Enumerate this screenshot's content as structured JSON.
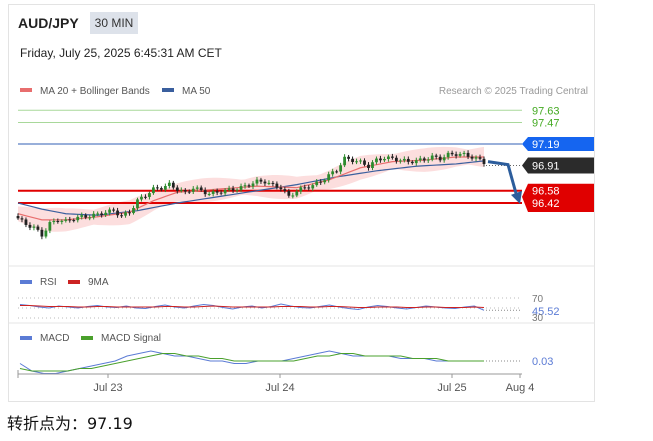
{
  "header": {
    "symbol": "AUD/JPY",
    "timeframe": "30 MIN",
    "datetime": "Friday, July 25, 2025 6:45:31 AM CET"
  },
  "legend": {
    "ma20": "MA 20 + Bollinger Bands",
    "ma50": "MA 50",
    "credit": "Research © 2025 Trading Central",
    "rsi": "RSI",
    "rsi_ma": "9MA",
    "macd": "MACD",
    "macd_signal": "MACD Signal"
  },
  "caption": "转折点为：97.19",
  "colors": {
    "up": "#2e8b2e",
    "down": "#222222",
    "ma20": "#e86e6e",
    "ma50": "#3a5f9e",
    "bands": "#fbd3d3",
    "pivot": "#1565f0",
    "support": "#e00000",
    "target": "#44aa22",
    "rsi": "#5b7bd5",
    "rsi_ma": "#cc2222",
    "macd_signal": "#4aa02c"
  },
  "chart_data": [
    {
      "type": "candlestick",
      "title": "AUD/JPY",
      "x_ticks": [
        "Jul 23",
        "Jul 24",
        "Jul 25",
        "Aug 4"
      ],
      "ylim": [
        95.8,
        97.8
      ],
      "levels": [
        {
          "value": 97.63,
          "label": "97.63",
          "role": "target"
        },
        {
          "value": 97.47,
          "label": "97.47",
          "role": "target"
        },
        {
          "value": 97.19,
          "label": "97.19",
          "role": "pivot"
        },
        {
          "value": 96.91,
          "label": "96.91",
          "role": "last"
        },
        {
          "value": 96.58,
          "label": "96.58",
          "role": "support"
        },
        {
          "value": 96.42,
          "label": "96.42",
          "role": "support"
        }
      ],
      "close_path": [
        [
          0,
          96.22
        ],
        [
          2,
          96.14
        ],
        [
          4,
          96.1
        ],
        [
          6,
          96.0
        ],
        [
          8,
          96.15
        ],
        [
          10,
          96.2
        ],
        [
          12,
          96.18
        ],
        [
          14,
          96.22
        ],
        [
          16,
          96.24
        ],
        [
          18,
          96.25
        ],
        [
          20,
          96.27
        ],
        [
          22,
          96.3
        ],
        [
          24,
          96.32
        ],
        [
          26,
          96.25
        ],
        [
          28,
          96.3
        ],
        [
          30,
          96.45
        ],
        [
          32,
          96.52
        ],
        [
          34,
          96.6
        ],
        [
          36,
          96.62
        ],
        [
          38,
          96.66
        ],
        [
          40,
          96.6
        ],
        [
          42,
          96.55
        ],
        [
          44,
          96.62
        ],
        [
          46,
          96.58
        ],
        [
          48,
          96.54
        ],
        [
          50,
          96.56
        ],
        [
          52,
          96.58
        ],
        [
          54,
          96.6
        ],
        [
          56,
          96.62
        ],
        [
          58,
          96.66
        ],
        [
          60,
          96.7
        ],
        [
          62,
          96.7
        ],
        [
          64,
          96.65
        ],
        [
          66,
          96.62
        ],
        [
          68,
          96.5
        ],
        [
          70,
          96.58
        ],
        [
          72,
          96.62
        ],
        [
          74,
          96.65
        ],
        [
          76,
          96.7
        ],
        [
          78,
          96.78
        ],
        [
          80,
          96.85
        ],
        [
          82,
          97.0
        ],
        [
          84,
          96.98
        ],
        [
          86,
          96.95
        ],
        [
          88,
          96.9
        ],
        [
          90,
          96.98
        ],
        [
          92,
          97.01
        ],
        [
          94,
          97.0
        ],
        [
          96,
          96.98
        ],
        [
          98,
          96.96
        ],
        [
          100,
          96.97
        ],
        [
          102,
          96.99
        ],
        [
          104,
          97.02
        ],
        [
          106,
          97.0
        ],
        [
          108,
          97.05
        ],
        [
          110,
          97.06
        ],
        [
          112,
          97.05
        ],
        [
          114,
          97.02
        ],
        [
          116,
          96.98
        ],
        [
          117,
          96.95
        ]
      ],
      "ma50_path": [
        [
          0,
          96.42
        ],
        [
          6,
          96.34
        ],
        [
          12,
          96.28
        ],
        [
          20,
          96.26
        ],
        [
          30,
          96.32
        ],
        [
          40,
          96.42
        ],
        [
          50,
          96.5
        ],
        [
          60,
          96.58
        ],
        [
          70,
          96.66
        ],
        [
          80,
          96.76
        ],
        [
          90,
          96.84
        ],
        [
          100,
          96.9
        ],
        [
          110,
          96.93
        ],
        [
          117,
          96.97
        ]
      ],
      "ma20_path": [
        [
          0,
          96.28
        ],
        [
          6,
          96.2
        ],
        [
          12,
          96.2
        ],
        [
          20,
          96.24
        ],
        [
          28,
          96.3
        ],
        [
          34,
          96.45
        ],
        [
          40,
          96.56
        ],
        [
          50,
          96.6
        ],
        [
          60,
          96.64
        ],
        [
          70,
          96.62
        ],
        [
          78,
          96.72
        ],
        [
          86,
          96.88
        ],
        [
          94,
          96.96
        ],
        [
          102,
          96.98
        ],
        [
          110,
          97.02
        ],
        [
          117,
          97.02
        ]
      ],
      "band_width": 0.12
    },
    {
      "type": "line",
      "title": "RSI",
      "y_ticks": [
        "70",
        "45.52",
        "30"
      ],
      "series": [
        {
          "name": "RSI",
          "values": [
            57,
            55,
            52,
            50,
            54,
            52,
            50,
            53,
            55,
            52,
            51,
            54,
            50,
            49,
            53,
            56,
            52,
            50,
            54,
            57,
            55,
            51,
            48,
            52,
            54,
            50,
            53,
            58,
            54,
            51,
            50,
            53,
            56,
            52,
            49,
            47,
            52,
            55,
            53,
            50,
            48,
            51,
            54,
            52,
            50,
            49,
            52,
            54,
            45.52
          ]
        },
        {
          "name": "9MA",
          "values": [
            55,
            55,
            54,
            53,
            53,
            53,
            52,
            52,
            53,
            53,
            52,
            52,
            52,
            52,
            52,
            53,
            53,
            52,
            52,
            53,
            54,
            53,
            52,
            52,
            52,
            52,
            52,
            53,
            53,
            53,
            52,
            52,
            53,
            53,
            52,
            51,
            51,
            52,
            52,
            52,
            51,
            51,
            52,
            52,
            51,
            51,
            51,
            52,
            51
          ]
        }
      ]
    },
    {
      "type": "line",
      "title": "MACD",
      "y_ticks": [
        "0.03"
      ],
      "series": [
        {
          "name": "MACD",
          "values": [
            0.02,
            -0.01,
            -0.02,
            -0.02,
            -0.01,
            0.0,
            0.01,
            0.02,
            0.03,
            0.05,
            0.06,
            0.07,
            0.06,
            0.05,
            0.05,
            0.04,
            0.03,
            0.03,
            0.02,
            0.02,
            0.03,
            0.03,
            0.03,
            0.04,
            0.05,
            0.06,
            0.07,
            0.06,
            0.05,
            0.05,
            0.05,
            0.05,
            0.04,
            0.04,
            0.04,
            0.03,
            0.03,
            0.03,
            0.03,
            0.03
          ]
        },
        {
          "name": "MACD Signal",
          "values": [
            0.0,
            -0.01,
            -0.01,
            -0.01,
            -0.01,
            0.0,
            0.0,
            0.01,
            0.02,
            0.03,
            0.04,
            0.05,
            0.06,
            0.06,
            0.05,
            0.05,
            0.04,
            0.04,
            0.03,
            0.03,
            0.03,
            0.03,
            0.03,
            0.03,
            0.04,
            0.05,
            0.05,
            0.06,
            0.06,
            0.05,
            0.05,
            0.05,
            0.05,
            0.04,
            0.04,
            0.04,
            0.03,
            0.03,
            0.03,
            0.03
          ]
        }
      ]
    }
  ]
}
